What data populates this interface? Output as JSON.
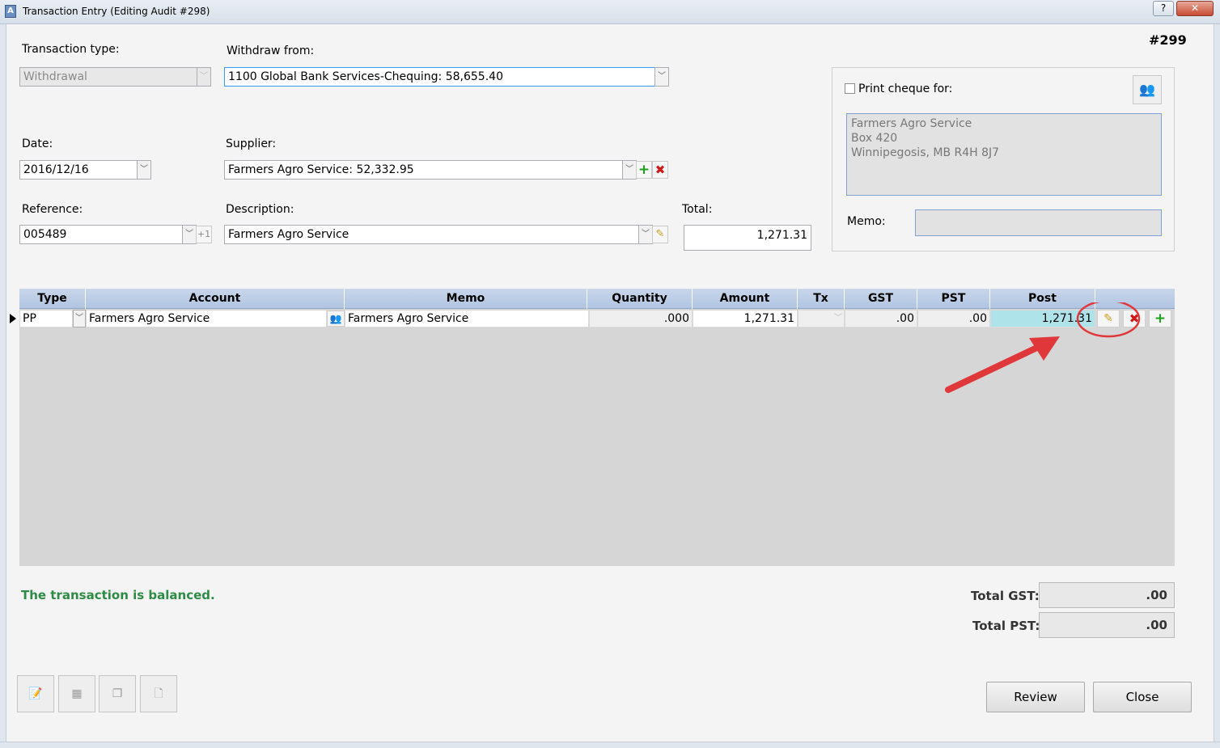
{
  "window": {
    "title": "Transaction Entry (Editing Audit #298)",
    "help_label": "?",
    "close_label": "✕",
    "transaction_number": "#299"
  },
  "form": {
    "transaction_type_label": "Transaction type:",
    "transaction_type_value": "Withdrawal",
    "withdraw_from_label": "Withdraw from:",
    "withdraw_from_value": "1100 Global Bank Services-Chequing: 58,655.40",
    "date_label": "Date:",
    "date_value": "2016/12/16",
    "supplier_label": "Supplier:",
    "supplier_value": "Farmers Agro Service: 52,332.95",
    "reference_label": "Reference:",
    "reference_value": "005489",
    "reference_increment": "+1",
    "description_label": "Description:",
    "description_value": "Farmers Agro Service",
    "total_label": "Total:",
    "total_value": "1,271.31"
  },
  "cheque": {
    "print_label": "Print cheque for:",
    "address_line1": "Farmers Agro Service",
    "address_line2": "Box 420",
    "address_line3": "Winnipegosis, MB R4H 8J7",
    "memo_label": "Memo:",
    "memo_value": ""
  },
  "grid": {
    "columns": [
      "Type",
      "Account",
      "Memo",
      "Quantity",
      "Amount",
      "Tx",
      "GST",
      "PST",
      "Post"
    ],
    "rows": [
      {
        "type": "PP",
        "account": "Farmers Agro Service",
        "memo": "Farmers Agro Service",
        "quantity": ".000",
        "amount": "1,271.31",
        "tx": "",
        "gst": ".00",
        "pst": ".00",
        "post": "1,271.31"
      }
    ]
  },
  "footer": {
    "status": "The transaction is balanced.",
    "total_gst_label": "Total GST:",
    "total_gst_value": ".00",
    "total_pst_label": "Total PST:",
    "total_pst_value": ".00",
    "review_label": "Review",
    "close_label": "Close"
  },
  "colors": {
    "grid_header": "#b1c5e2",
    "post_cell": "#aee3ea",
    "balanced_text": "#2e8b46",
    "annotation": "#e0383a"
  },
  "icons": [
    "app-icon",
    "help-icon",
    "close-icon",
    "dropdown-icon",
    "add-icon",
    "delete-icon",
    "pencil-icon",
    "people-icon",
    "row-pointer-icon",
    "edit-note-icon",
    "calculator-icon",
    "copy-icon",
    "add-document-icon"
  ]
}
